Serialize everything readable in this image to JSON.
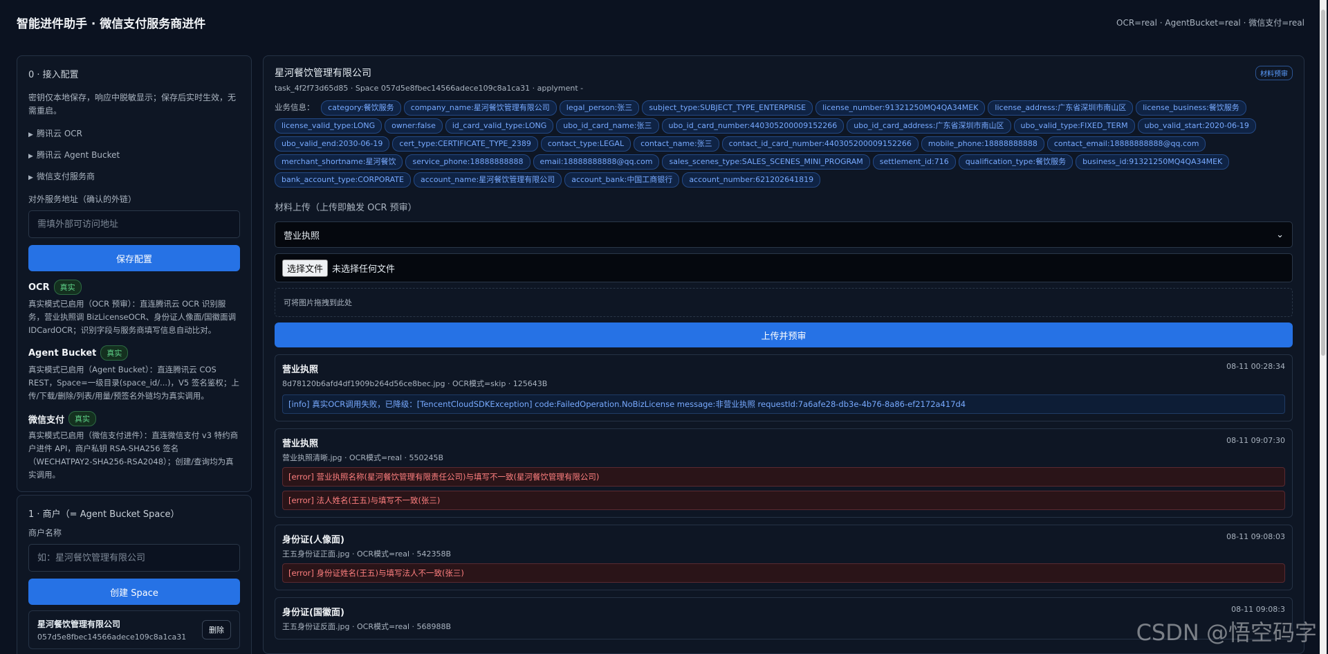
{
  "header": {
    "title": "智能进件助手 · 微信支付服务商进件",
    "status": "OCR=real · AgentBucket=real · 微信支付=real"
  },
  "config": {
    "title": "0 · 接入配置",
    "hint": "密钥仅本地保存，响应中脱敏显示；保存后实时生效，无需重启。",
    "sections": [
      "腾讯云 OCR",
      "腾讯云 Agent Bucket",
      "微信支付服务商"
    ],
    "public_url_label": "对外服务地址（确认的外链）",
    "public_url_placeholder": "需填外部可访问地址",
    "save_label": "保存配置",
    "modes": [
      {
        "name": "OCR",
        "badge": "真实",
        "desc": "真实模式已启用（OCR 预审）：直连腾讯云 OCR 识别服务，营业执照调 BizLicenseOCR、身份证人像面/国徽面调 IDCardOCR；识别字段与服务商填写信息自动比对。"
      },
      {
        "name": "Agent Bucket",
        "badge": "真实",
        "desc": "真实模式已启用（Agent Bucket）：直连腾讯云 COS REST，Space=一级目录(space_id/...)，V5 签名鉴权；上传/下载/删除/列表/用量/预签名外链均为真实调用。"
      },
      {
        "name": "微信支付",
        "badge": "真实",
        "desc": "真实模式已启用（微信支付进件）：直连微信支付 v3 特约商户进件 API，商户私钥 RSA-SHA256 签名（WECHATPAY2-SHA256-RSA2048）；创建/查询均为真实调用。"
      }
    ]
  },
  "merchant_panel": {
    "title": "1 · 商户（= Agent Bucket Space）",
    "name_label": "商户名称",
    "name_placeholder": "如：星河餐饮管理有限公司",
    "create_label": "创建 Space",
    "space": {
      "name": "星河餐饮管理有限公司",
      "id": "057d5e8fbec14566adece109c8a1ca31",
      "delete_label": "删除"
    }
  },
  "detail": {
    "name": "星河餐饮管理有限公司",
    "meta": "task_4f2f73d65d85 · Space 057d5e8fbec14566adece109c8a1ca31 · applyment -",
    "pretag": "材料预审",
    "biz_label": "业务信息：",
    "biz_chips": [
      "category:餐饮服务",
      "company_name:星河餐饮管理有限公司",
      "legal_person:张三",
      "subject_type:SUBJECT_TYPE_ENTERPRISE",
      "license_number:91321250MQ4QA34MEK",
      "license_address:广东省深圳市南山区",
      "license_business:餐饮服务",
      "license_valid_type:LONG",
      "owner:false",
      "id_card_valid_type:LONG",
      "ubo_id_card_name:张三",
      "ubo_id_card_number:440305200009152266",
      "ubo_id_card_address:广东省深圳市南山区",
      "ubo_valid_type:FIXED_TERM",
      "ubo_valid_start:2020-06-19",
      "ubo_valid_end:2030-06-19",
      "cert_type:CERTIFICATE_TYPE_2389",
      "contact_type:LEGAL",
      "contact_name:张三",
      "contact_id_card_number:440305200009152266",
      "mobile_phone:18888888888",
      "contact_email:18888888888@qq.com",
      "merchant_shortname:星河餐饮",
      "service_phone:18888888888",
      "email:18888888888@qq.com",
      "sales_scenes_type:SALES_SCENES_MINI_PROGRAM",
      "settlement_id:716",
      "qualification_type:餐饮服务",
      "business_id:91321250MQ4QA34MEK",
      "bank_account_type:CORPORATE",
      "account_name:星河餐饮管理有限公司",
      "account_bank:中国工商银行",
      "account_number:621202641819"
    ],
    "upload_label": "材料上传（上传即触发 OCR 预审）",
    "select_value": "营业执照",
    "file_button": "选择文件",
    "file_text": "未选择任何文件",
    "drop_text": "可将图片拖拽到此处",
    "upload_button": "上传并预审",
    "records": [
      {
        "title": "营业执照",
        "time": "08-11 00:28:34",
        "meta": "8d78120b6afd4df1909b264d56ce8bec.jpg · OCR模式=skip · 125643B",
        "messages": [
          {
            "level": "info",
            "text": "[info] 真实OCR调用失败，已降级：[TencentCloudSDKException] code:FailedOperation.NoBizLicense message:非营业执照 requestId:7a6afe28-db3e-4b76-8a86-ef2172a417d4"
          }
        ]
      },
      {
        "title": "营业执照",
        "time": "08-11 09:07:30",
        "meta": "营业执照清晰.jpg · OCR模式=real · 550245B",
        "messages": [
          {
            "level": "error",
            "text": "[error] 营业执照名称(星河餐饮管理有限责任公司)与填写不一致(星河餐饮管理有限公司)"
          },
          {
            "level": "error",
            "text": "[error] 法人姓名(王五)与填写不一致(张三)"
          }
        ]
      },
      {
        "title": "身份证(人像面)",
        "time": "08-11 09:08:03",
        "meta": "王五身份证正面.jpg · OCR模式=real · 542358B",
        "messages": [
          {
            "level": "error",
            "text": "[error] 身份证姓名(王五)与填写法人不一致(张三)"
          }
        ]
      },
      {
        "title": "身份证(国徽面)",
        "time": "08-11 09:08:3",
        "meta": "王五身份证反面.jpg · OCR模式=real · 568988B",
        "messages": []
      }
    ]
  },
  "watermark": "CSDN @悟空码字"
}
